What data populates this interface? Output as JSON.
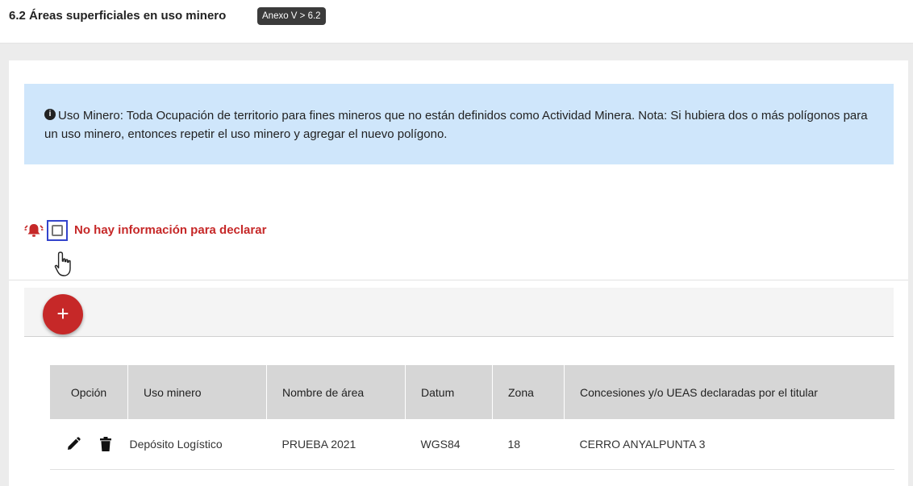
{
  "header": {
    "title": "6.2 Áreas superficiales en uso minero",
    "badge": "Anexo V > 6.2"
  },
  "info": {
    "icon": "info-circle-icon",
    "text": "Uso Minero: Toda Ocupación de territorio para fines mineros que no están definidos como Actividad Minera. Nota: Si hubiera dos o más polígonos para un uso minero, entonces repetir el uso minero y agregar el nuevo polígono."
  },
  "declare": {
    "label": "No hay información para declarar",
    "checked": false,
    "icon": "bell-alert-icon"
  },
  "toolbar": {
    "add_label": "+"
  },
  "table": {
    "columns": [
      "Opción",
      "Uso minero",
      "Nombre de área",
      "Datum",
      "Zona",
      "Concesiones y/o UEAS declaradas por el titular"
    ],
    "rows": [
      [
        "Depósito Logístico",
        "PRUEBA 2021",
        "WGS84",
        "18",
        "CERRO ANYALPUNTA 3"
      ]
    ]
  },
  "colors": {
    "accent": "#c62828",
    "info_bg": "#cfe6fb",
    "header_cell": "#d6d6d6",
    "focus_ring": "#3344cc"
  }
}
